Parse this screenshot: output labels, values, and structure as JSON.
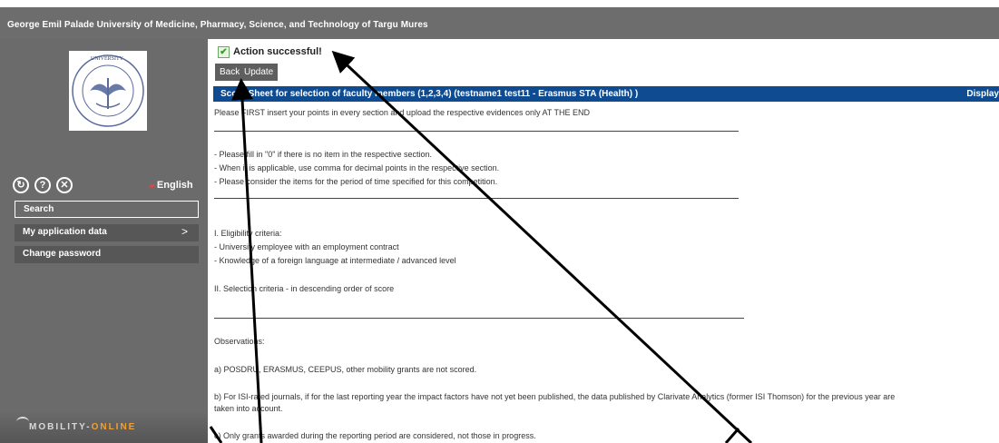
{
  "header": {
    "title": "George Emil Palade University of Medicine, Pharmacy, Science, and Technology of Targu Mures"
  },
  "sidebar": {
    "logo_text": "UNIVERSITY",
    "icons": [
      "refresh-icon",
      "help-icon",
      "close-icon"
    ],
    "language": "English",
    "items": [
      {
        "label": "Search"
      },
      {
        "label": "My application data",
        "chevron": ">"
      },
      {
        "label": "Change password"
      }
    ],
    "brand": {
      "part1": "MOBILITY-",
      "part2": "ONLINE"
    }
  },
  "main": {
    "status": "Action successful!",
    "buttons": {
      "back": "Back",
      "update": "Update"
    },
    "sheet_title": "Score Sheet for selection of faculty members (1,2,3,4) (testname1 test11 - Erasmus STA (Health) )",
    "display_label": "Display",
    "intro": "Please FIRST insert your points in every section and upload the respective evidences only AT THE END",
    "notes": [
      "- Please fill in \"0\" if there is no item in the respective section.",
      "- When it is applicable, use comma for decimal points in the respective section.",
      "- Please consider the items for the period of time specified for this competition."
    ],
    "eligibility": [
      "I. Eligibility criteria:",
      "- University employee with an employment contract",
      "- Knowledge of a foreign language at intermediate / advanced level"
    ],
    "selection": "II. Selection criteria - in descending order of score",
    "observations_title": "Observations:",
    "obs_a": "a) POSDRU, ERASMUS, CEEPUS, other mobility grants are not scored.",
    "obs_b1": "b) For ISI-rated journals, if for the last reporting year the impact factors have not yet been published, the data published by Clarivate Analytics (former ISI Thomson) for the previous year are",
    "obs_b2": "taken into account.",
    "obs_c": "c) Only grants awarded during the reporting period are considered, not those in progress."
  },
  "colors": {
    "header_bg": "#6d6d6d",
    "sidebar_bg": "#6b6b6b",
    "sheet_header_bg": "#0e4b91",
    "accent_orange": "#f0a030"
  }
}
